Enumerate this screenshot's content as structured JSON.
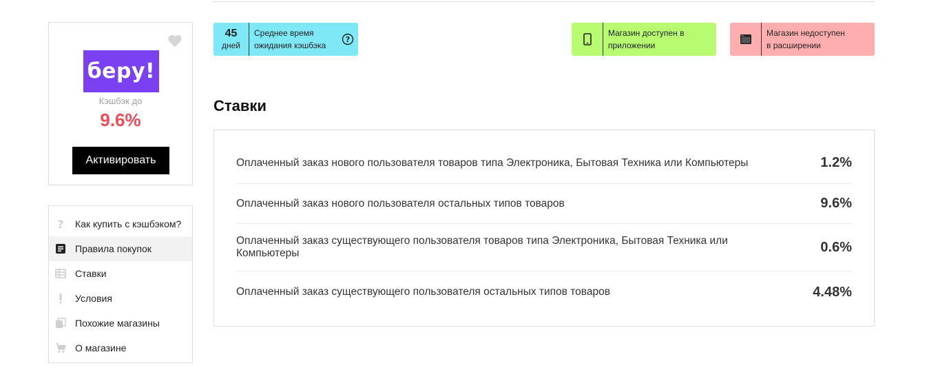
{
  "store": {
    "logo_text": "беру!",
    "cashback_label": "Кэшбэк до",
    "cashback_value": "9.6%",
    "activate_label": "Активировать",
    "brand_color": "#7a40f2",
    "accent_color": "#ef4c57"
  },
  "menu": {
    "items": [
      {
        "label": "Как купить с кэшбэком?",
        "icon": "question-icon"
      },
      {
        "label": "Правила покупок",
        "icon": "rules-icon",
        "active": true
      },
      {
        "label": "Ставки",
        "icon": "table-icon"
      },
      {
        "label": "Условия",
        "icon": "exclamation-icon"
      },
      {
        "label": "Похожие магазины",
        "icon": "copy-icon"
      },
      {
        "label": "О магазине",
        "icon": "cart-icon"
      }
    ]
  },
  "badges": {
    "wait": {
      "number": "45",
      "unit": "дней",
      "text": "Среднее время ожидания кэшбэка",
      "color": "#7fe8f6"
    },
    "app": {
      "text": "Магазин доступен в приложении",
      "icon": "phone-icon",
      "color": "#b9fb70"
    },
    "ext": {
      "text": "Магазин недоступен в расширении",
      "icon": "browser-window-icon",
      "color": "#ffaeb0"
    }
  },
  "rates": {
    "title": "Ставки",
    "rows": [
      {
        "description": "Оплаченный заказ нового пользователя товаров типа Электроника, Бытовая Техника или Компьютеры",
        "value": "1.2%"
      },
      {
        "description": "Оплаченный заказ нового пользователя остальных типов товаров",
        "value": "9.6%"
      },
      {
        "description": "Оплаченный заказ существующего пользователя товаров типа Электроника, Бытовая Техника или Компьютеры",
        "value": "0.6%"
      },
      {
        "description": "Оплаченный заказ существующего пользователя остальных типов товаров",
        "value": "4.48%"
      }
    ]
  }
}
